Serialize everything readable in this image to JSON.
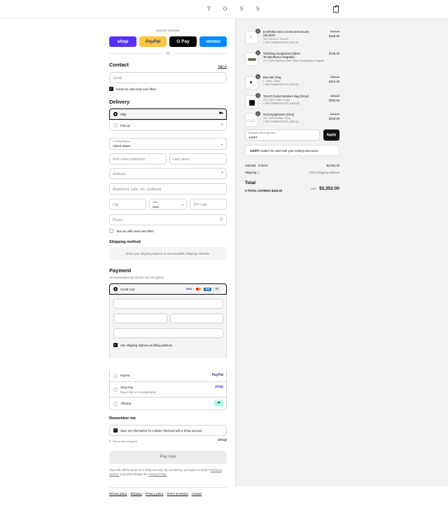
{
  "header": {
    "logo": "T O S S"
  },
  "express": {
    "title": "Express checkout",
    "or": "OR",
    "shop": "shop",
    "paypal": "PayPal",
    "gpay": "G Pay",
    "venmo": "venmo"
  },
  "contact": {
    "title": "Contact",
    "sign_in": "Sign in",
    "email_placeholder": "Email",
    "email_news": "Email me with news and offers"
  },
  "delivery": {
    "title": "Delivery",
    "ship": "Ship",
    "pickup": "Pick up",
    "country_label": "Country/Region",
    "country": "United States",
    "first_name": "First name (optional)",
    "last_name": "Last name",
    "address": "Address",
    "apartment": "Apartment, suite, etc. (optional)",
    "city": "City",
    "state_label": "State",
    "state": "Iowa",
    "zip": "ZIP code",
    "phone": "Phone",
    "text_news": "Text me with news and offers"
  },
  "shipping_method": {
    "title": "Shipping method",
    "notice": "Enter your shipping address to view available shipping methods."
  },
  "payment": {
    "title": "Payment",
    "subtitle": "All transactions are secure and encrypted.",
    "credit_card": "Credit card",
    "card_more": "+5",
    "billing_same": "Use shipping address as billing address",
    "paypal": "PayPal",
    "paypal_logo": "PayPal",
    "shop_pay": "Shop Pay",
    "shop_pay_sub": "Pay in full or in installments",
    "shop_logo": "shop",
    "afterpay": "Afterpay"
  },
  "remember": {
    "title": "Remember me",
    "save_info": "Save my information for a faster checkout with a Shop account",
    "secure": "Secure and encrypted",
    "shop_logo": "shop"
  },
  "pay_now": "Pay now",
  "legal": {
    "prefix": "Your info will be saved to a Shop account. By continuing, you agree to Shop's",
    "terms": "Terms of Service",
    "middle": "and acknowledge the",
    "privacy": "Privacy Policy",
    "end": "."
  },
  "footer_links": [
    "Refund policy",
    "Shipping",
    "Privacy policy",
    "Terms of service",
    "Contact"
  ],
  "items": [
    {
      "qty": "1",
      "name": "EARRING W/2 CHAIN SHACKLES (SILVER)",
      "variant": "OS / 100% SL / SILVER",
      "discount": "SEPTEMBEROFFER (-$42.00)",
      "old": "$210.00",
      "price": "$168.00"
    },
    {
      "qty": "1",
      "name": "Shielding Sunglasses (Silver Temple/Bosco Degrade)",
      "variant": "OS / 100% Stainless Steel / Silver Temple/Bosco Degrade",
      "discount": "",
      "old": "",
      "price": "$740.00"
    },
    {
      "qty": "1",
      "name": "Barcode Ring",
      "variant": "L / Silver / Brass",
      "discount": "SEPTEMBEROFFER (-$78.00)",
      "old": "$390.00",
      "price": "$312.00"
    },
    {
      "qty": "1",
      "name": "Trench Pocket Medium Bag (Onyx)",
      "variant": "OS / 100% Cotton / Onyx",
      "discount": "SEPTEMBEROFFER (-$198.00)",
      "old": "$990.00",
      "price": "$792.00"
    },
    {
      "qty": "1",
      "name": "Oval Eyeglasses (Grey)",
      "variant": "OS / 100% Acetate / Grey",
      "discount": "SEPTEMBEROFFER (-$85.00)",
      "old": "$425.00",
      "price": "$340.00"
    }
  ],
  "discount": {
    "label": "Discount code or gift card",
    "value": "10OFF",
    "apply": "Apply",
    "error_code": "10OFF",
    "error_text": "couldn't be used with your existing discounts."
  },
  "summary": {
    "subtotal_label": "Subtotal · 5 items",
    "subtotal": "$2,352.00",
    "shipping_label": "Shipping",
    "shipping_value": "Enter shipping address",
    "total_label": "Total",
    "currency": "USD",
    "total": "$2,352.00",
    "savings_label": "TOTAL SAVINGS",
    "savings": "$403.00"
  },
  "colors": {
    "shop": "#5a31f4",
    "paypal": "#ffc439",
    "gpay": "#000000",
    "venmo": "#008cff"
  }
}
